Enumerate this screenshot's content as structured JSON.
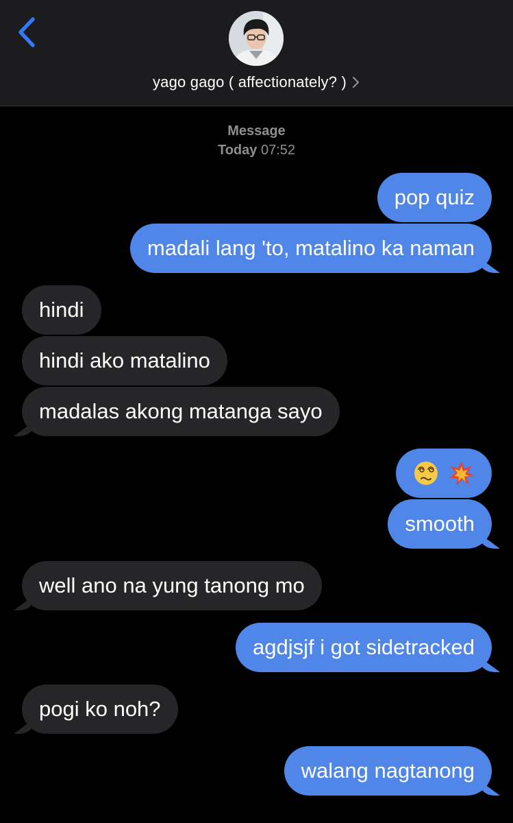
{
  "header": {
    "back_icon": "chevron-left-icon",
    "avatar_icon": "contact-photo",
    "contact_name": "yago gago ( affectionately? )",
    "disclosure_icon": "chevron-right-icon",
    "accent_color": "#3478f6"
  },
  "conversation_meta": {
    "service": "Message",
    "day": "Today",
    "time": "07:52"
  },
  "colors": {
    "sent_bubble": "#4f86e8",
    "received_bubble": "#262628",
    "background": "#000000",
    "meta_text": "#8e8e93"
  },
  "messages": [
    {
      "direction": "sent",
      "text": "pop quiz"
    },
    {
      "direction": "sent",
      "text": "madali lang 'to, matalino ka naman"
    },
    {
      "direction": "received",
      "text": "hindi"
    },
    {
      "direction": "received",
      "text": "hindi ako matalino"
    },
    {
      "direction": "received",
      "text": "madalas akong matanga sayo"
    },
    {
      "direction": "sent",
      "emojis": [
        "dizzy-face-emoji",
        "collision-emoji"
      ]
    },
    {
      "direction": "sent",
      "text": "smooth"
    },
    {
      "direction": "received",
      "text": "well ano na yung tanong mo"
    },
    {
      "direction": "sent",
      "text": "agdjsjf i got sidetracked"
    },
    {
      "direction": "received",
      "text": "pogi ko noh?"
    },
    {
      "direction": "sent",
      "text": "walang nagtanong"
    }
  ]
}
